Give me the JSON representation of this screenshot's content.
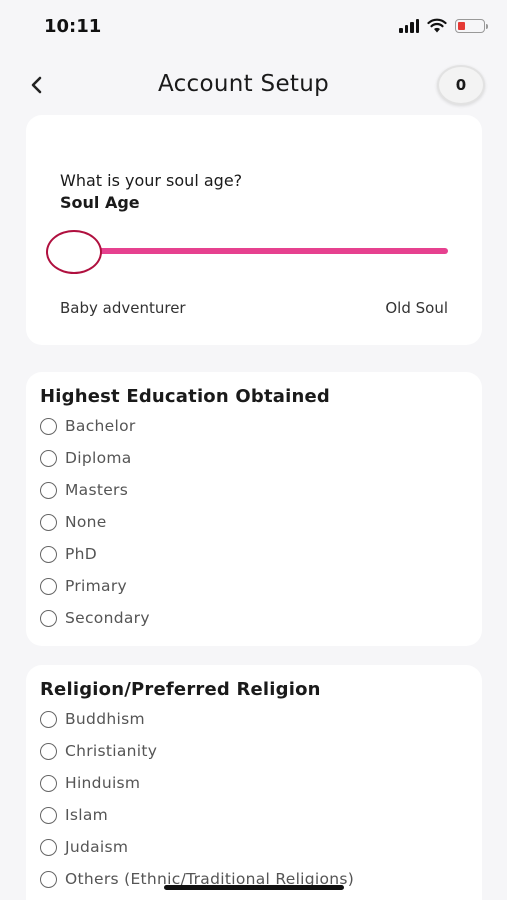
{
  "status_bar": {
    "time": "10:11"
  },
  "header": {
    "title": "Account Setup",
    "counter": "0",
    "back_icon": "chevron-left-icon"
  },
  "soul_age": {
    "question": "What is your soul age?",
    "label": "Soul Age",
    "min_label": "Baby adventurer",
    "max_label": "Old Soul",
    "value": 0,
    "accent_color": "#e6418f"
  },
  "education": {
    "title": "Highest Education Obtained",
    "options": [
      "Bachelor",
      "Diploma",
      "Masters",
      "None",
      "PhD",
      "Primary",
      "Secondary"
    ]
  },
  "religion": {
    "title": "Religion/Preferred Religion",
    "options": [
      "Buddhism",
      "Christianity",
      "Hinduism",
      "Islam",
      "Judaism",
      "Others (Ethnic/Traditional Religions)"
    ]
  }
}
